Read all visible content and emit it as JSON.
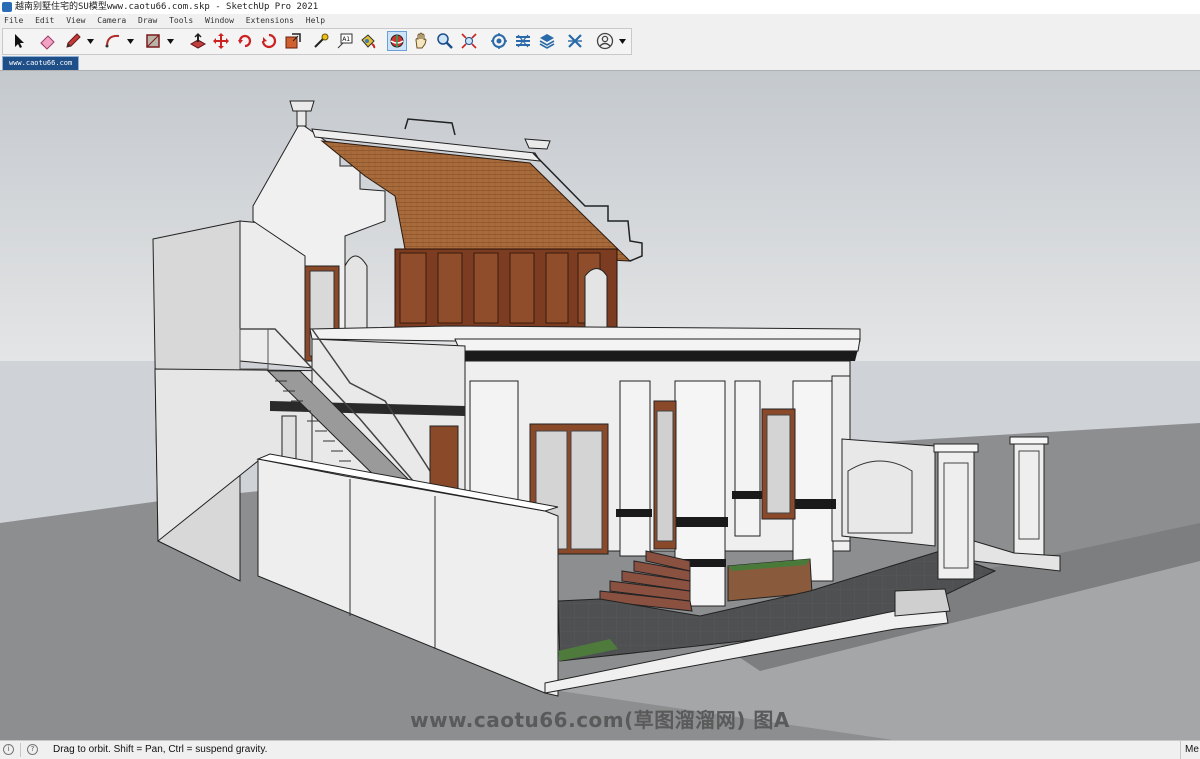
{
  "window": {
    "title": "越南别墅住宅的SU模型www.caotu66.com.skp - SketchUp Pro 2021"
  },
  "menu": [
    "File",
    "Edit",
    "View",
    "Camera",
    "Draw",
    "Tools",
    "Window",
    "Extensions",
    "Help"
  ],
  "toolbar": {
    "tools": [
      {
        "icon": "select-arrow-icon"
      },
      {
        "icon": "eraser-icon"
      },
      {
        "icon": "pencil-line-icon"
      },
      {
        "icon": "arc-icon"
      },
      {
        "icon": "rectangle-icon"
      },
      {
        "icon": "push-pull-icon"
      },
      {
        "icon": "move-icon"
      },
      {
        "icon": "rotate-icon"
      },
      {
        "icon": "scale-icon"
      },
      {
        "icon": "tape-measure-icon"
      },
      {
        "icon": "text-icon"
      },
      {
        "icon": "paint-bucket-icon"
      },
      {
        "icon": "orbit-icon",
        "active": true
      },
      {
        "icon": "pan-icon"
      },
      {
        "icon": "zoom-icon"
      },
      {
        "icon": "zoom-extents-icon"
      },
      {
        "icon": "3d-warehouse-icon"
      },
      {
        "icon": "extension-warehouse-icon"
      },
      {
        "icon": "layout-icon"
      },
      {
        "icon": "extension-manager-icon"
      },
      {
        "icon": "account-icon"
      }
    ],
    "text_tool_glyph": "A1"
  },
  "scene_tab": {
    "label": "www.caotu66.com"
  },
  "viewport": {
    "watermark": "www.caotu66.com(草图溜溜网) 图A",
    "colors": {
      "sky": "#d3d6d9",
      "ground": "#8b8c8e",
      "wall": "#ececec",
      "roof": "#a86a3a",
      "wood": "#8a4a2a"
    }
  },
  "status": {
    "message": "Drag to orbit. Shift = Pan, Ctrl = suspend gravity.",
    "right_text": "Me"
  }
}
